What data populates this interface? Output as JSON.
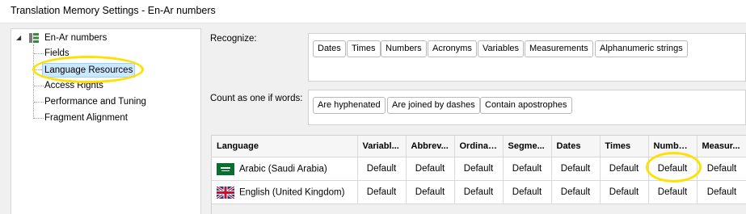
{
  "window": {
    "title": "Translation Memory Settings - En-Ar numbers"
  },
  "tree": {
    "root": {
      "label": "En-Ar numbers",
      "icon": "database-icon",
      "expanded": true
    },
    "children": [
      {
        "label": "Fields"
      },
      {
        "label": "Language Resources",
        "selected": true
      },
      {
        "label": "Access Rights"
      },
      {
        "label": "Performance and Tuning"
      },
      {
        "label": "Fragment Alignment"
      }
    ]
  },
  "recognize": {
    "label": "Recognize:",
    "items": [
      "Dates",
      "Times",
      "Numbers",
      "Acronyms",
      "Variables",
      "Measurements",
      "Alphanumeric strings"
    ]
  },
  "count_as_one": {
    "label": "Count as one if words:",
    "items": [
      "Are hyphenated",
      "Are joined by dashes",
      "Contain apostrophes"
    ]
  },
  "grid": {
    "columns": [
      "Language",
      "Variabl...",
      "Abbrev...",
      "Ordinal...",
      "Segme...",
      "Dates",
      "Times",
      "Numbers",
      "Measur..."
    ],
    "rows": [
      {
        "language": "Arabic (Saudi Arabia)",
        "flag": "saudi-arabia-flag-icon",
        "values": [
          "Default",
          "Default",
          "Default",
          "Default",
          "Default",
          "Default",
          "Default",
          "Default"
        ]
      },
      {
        "language": "English (United Kingdom)",
        "flag": "united-kingdom-flag-icon",
        "values": [
          "Default",
          "Default",
          "Default",
          "Default",
          "Default",
          "Default",
          "Default",
          "Default"
        ]
      }
    ]
  },
  "colors": {
    "highlight_circle": "#ffe000",
    "selection": "#cce8ff"
  }
}
